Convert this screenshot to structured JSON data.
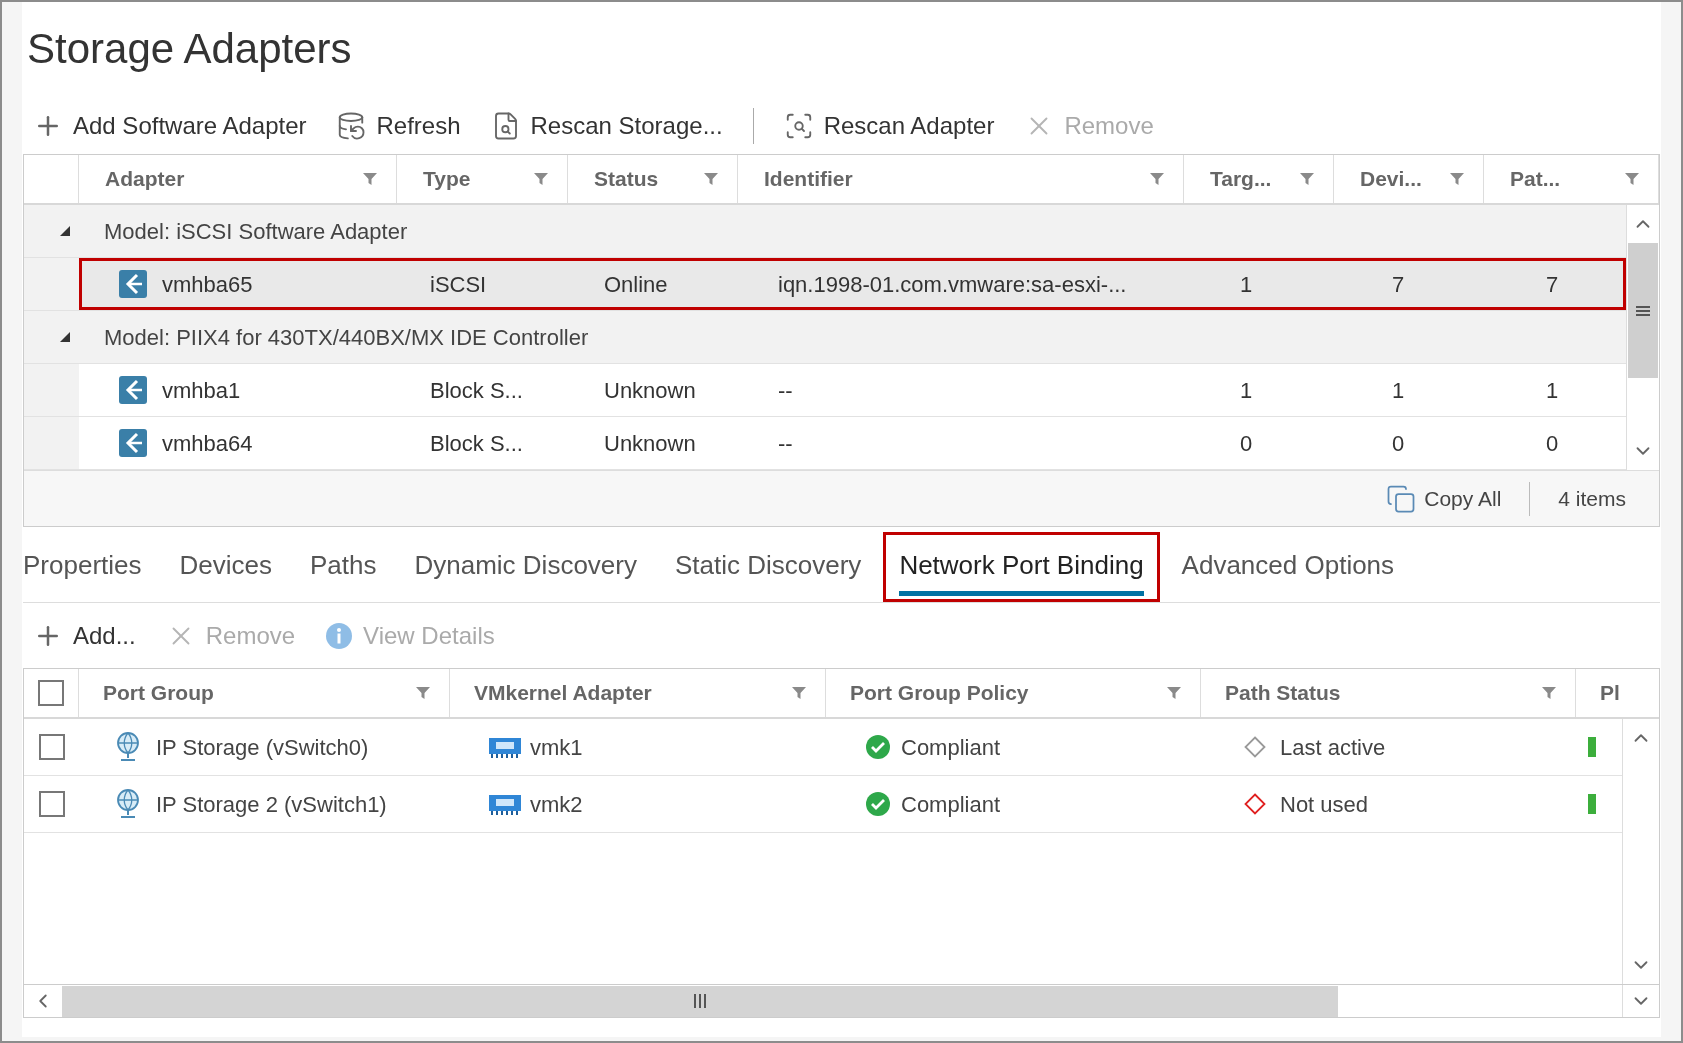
{
  "title": "Storage Adapters",
  "toolbar": [
    {
      "kind": "add",
      "label": "Add Software Adapter",
      "disabled": false
    },
    {
      "kind": "refresh",
      "label": "Refresh",
      "disabled": false
    },
    {
      "kind": "rescan-storage",
      "label": "Rescan Storage...",
      "disabled": false
    },
    {
      "kind": "separator"
    },
    {
      "kind": "rescan-adapter",
      "label": "Rescan Adapter",
      "disabled": false
    },
    {
      "kind": "remove",
      "label": "Remove",
      "disabled": true
    }
  ],
  "adapters_table": {
    "columns": [
      "Adapter",
      "Type",
      "Status",
      "Identifier",
      "Targ...",
      "Devi...",
      "Pat..."
    ],
    "groups": [
      {
        "label": "Model: iSCSI Software Adapter",
        "expanded": true,
        "rows": [
          {
            "cells": [
              "vmhba65",
              "iSCSI",
              "Online",
              "iqn.1998-01.com.vmware:sa-esxi-...",
              "1",
              "7",
              "7"
            ],
            "selected": true,
            "highlighted": true
          }
        ]
      },
      {
        "label": "Model: PIIX4 for 430TX/440BX/MX IDE Controller",
        "expanded": true,
        "rows": [
          {
            "cells": [
              "vmhba1",
              "Block S...",
              "Unknown",
              "--",
              "1",
              "1",
              "1"
            ],
            "selected": false,
            "highlighted": false
          },
          {
            "cells": [
              "vmhba64",
              "Block S...",
              "Unknown",
              "--",
              "0",
              "0",
              "0"
            ],
            "selected": false,
            "highlighted": false
          }
        ]
      }
    ],
    "footer": {
      "copy_all": "Copy All",
      "count": "4 items"
    }
  },
  "tabs": [
    {
      "label": "Properties",
      "selected": false,
      "highlighted": false
    },
    {
      "label": "Devices",
      "selected": false,
      "highlighted": false
    },
    {
      "label": "Paths",
      "selected": false,
      "highlighted": false
    },
    {
      "label": "Dynamic Discovery",
      "selected": false,
      "highlighted": false
    },
    {
      "label": "Static Discovery",
      "selected": false,
      "highlighted": false
    },
    {
      "label": "Network Port Binding",
      "selected": true,
      "highlighted": true
    },
    {
      "label": "Advanced Options",
      "selected": false,
      "highlighted": false
    }
  ],
  "binding_toolbar": [
    {
      "kind": "add",
      "label": "Add...",
      "disabled": false
    },
    {
      "kind": "remove",
      "label": "Remove",
      "disabled": true
    },
    {
      "kind": "info",
      "label": "View Details",
      "disabled": true
    }
  ],
  "binding_table": {
    "select_all_checked": false,
    "columns": [
      "Port Group",
      "VMkernel Adapter",
      "Port Group Policy",
      "Path Status",
      "Pl"
    ],
    "rows": [
      {
        "checked": false,
        "port_group": "IP Storage (vSwitch0)",
        "vmkernel_adapter": "vmk1",
        "policy": "Compliant",
        "path_status": "Last active",
        "color": "#999999"
      },
      {
        "checked": false,
        "port_group": "IP Storage 2 (vSwitch1)",
        "vmkernel_adapter": "vmk2",
        "policy": "Compliant",
        "path_status": "Not used",
        "color": "#e02020"
      }
    ]
  }
}
